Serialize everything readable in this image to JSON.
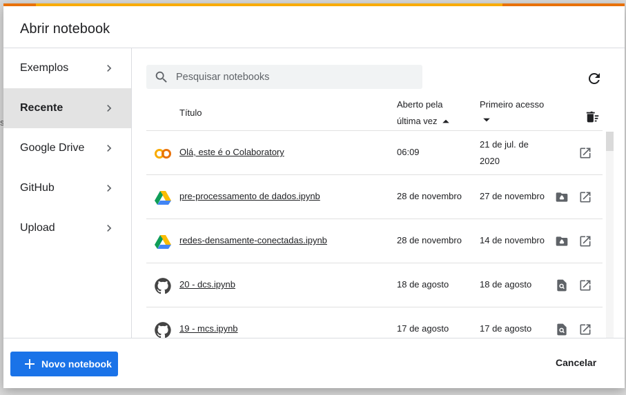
{
  "dialog": {
    "title": "Abrir notebook",
    "colors": {
      "accent_orange": "#e8710a",
      "accent_yellow": "#f9ab00",
      "primary_blue": "#1a73e8"
    }
  },
  "background": {
    "fragment": "st"
  },
  "sidebar": {
    "items": [
      {
        "label": "Exemplos",
        "active": false
      },
      {
        "label": "Recente",
        "active": true
      },
      {
        "label": "Google Drive",
        "active": false
      },
      {
        "label": "GitHub",
        "active": false
      },
      {
        "label": "Upload",
        "active": false
      }
    ]
  },
  "search": {
    "placeholder": "Pesquisar notebooks",
    "icon": "search-icon"
  },
  "table": {
    "headers": {
      "title": "Título",
      "opened_line1": "Aberto pela",
      "opened_line2": "última vez",
      "first_access": "Primeiro acesso"
    },
    "rows": [
      {
        "source": "colab",
        "name": "Olá, este é o Colaboratory",
        "opened": "06:09",
        "first_line1": "21 de jul. de",
        "first_line2": "2020"
      },
      {
        "source": "drive",
        "name": "pre-processamento de dados.ipynb",
        "opened": "28 de novembro",
        "first": "27 de novembro"
      },
      {
        "source": "drive",
        "name": "redes-densamente-conectadas.ipynb",
        "opened": "28 de novembro",
        "first": "14 de novembro"
      },
      {
        "source": "github",
        "name": "20 - dcs.ipynb",
        "opened": "18 de agosto",
        "first": "18 de agosto"
      },
      {
        "source": "github",
        "name": "19 - mcs.ipynb",
        "opened": "17 de agosto",
        "first": "17 de agosto"
      }
    ]
  },
  "footer": {
    "new_label": "Novo notebook",
    "cancel_label": "Cancelar"
  }
}
